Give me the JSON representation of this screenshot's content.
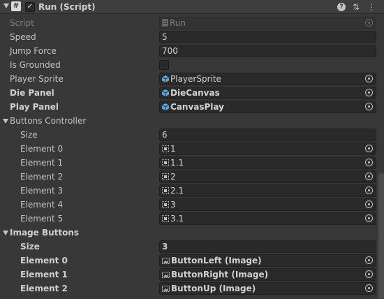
{
  "component": {
    "title": "Run (Script)",
    "hash_icon": "#",
    "enabled_check": "✓"
  },
  "props": {
    "script": {
      "label": "Script",
      "value": "Run"
    },
    "speed": {
      "label": "Speed",
      "value": "5"
    },
    "jump_force": {
      "label": "Jump Force",
      "value": "700"
    },
    "is_grounded": {
      "label": "Is Grounded",
      "checked": false
    },
    "player_sprite": {
      "label": "Player Sprite",
      "value": "PlayerSprite"
    },
    "die_panel": {
      "label": "Die Panel",
      "value": "DieCanvas"
    },
    "play_panel": {
      "label": "Play Panel",
      "value": "CanvasPlay"
    }
  },
  "buttons_controller": {
    "label": "Buttons Controller",
    "size_label": "Size",
    "size": "6",
    "elements": [
      {
        "label": "Element 0",
        "value": "1"
      },
      {
        "label": "Element 1",
        "value": "1.1"
      },
      {
        "label": "Element 2",
        "value": "2"
      },
      {
        "label": "Element 3",
        "value": "2.1"
      },
      {
        "label": "Element 4",
        "value": "3"
      },
      {
        "label": "Element 5",
        "value": "3.1"
      }
    ]
  },
  "image_buttons": {
    "label": "Image Buttons",
    "size_label": "Size",
    "size": "3",
    "elements": [
      {
        "label": "Element 0",
        "value": "ButtonLeft (Image)"
      },
      {
        "label": "Element 1",
        "value": "ButtonRight (Image)"
      },
      {
        "label": "Element 2",
        "value": "ButtonUp (Image)"
      }
    ]
  },
  "icons": {
    "help": "?",
    "settings": "⇅",
    "more": "⋮"
  },
  "colors": {
    "panel": "#383838",
    "field": "#2a2a2a",
    "text": "#c4c4c4",
    "prefab_blue": "#5aa7e0"
  }
}
